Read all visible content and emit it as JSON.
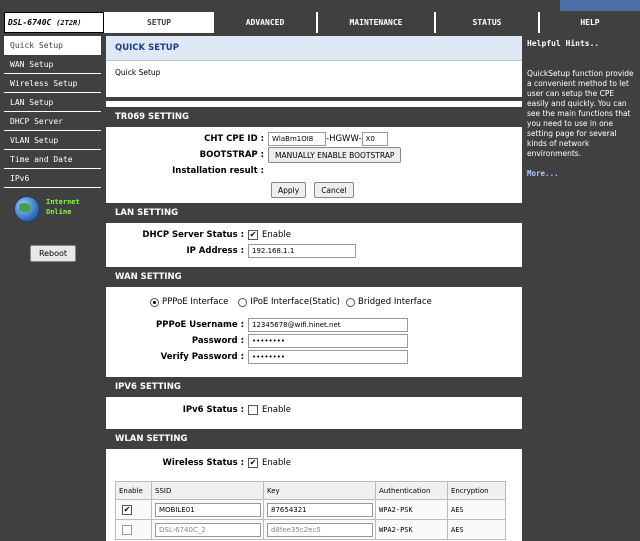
{
  "header": {
    "model": "DSL-6740C",
    "model_sub": "(2T2R)",
    "tabs": [
      {
        "label": "SETUP"
      },
      {
        "label": "ADVANCED"
      },
      {
        "label": "MAINTENANCE"
      },
      {
        "label": "STATUS"
      },
      {
        "label": "HELP"
      }
    ]
  },
  "sidebar": {
    "items": [
      {
        "label": "Quick Setup"
      },
      {
        "label": "WAN Setup"
      },
      {
        "label": "Wireless Setup"
      },
      {
        "label": "LAN Setup"
      },
      {
        "label": "DHCP Server"
      },
      {
        "label": "VLAN Setup"
      },
      {
        "label": "Time and Date"
      },
      {
        "label": "IPv6"
      }
    ],
    "status_line1": "Internet",
    "status_line2": "Online",
    "reboot_label": "Reboot"
  },
  "quick_setup": {
    "title": "QUICK SETUP",
    "body": "Quick Setup"
  },
  "tr069": {
    "title": "TR069 SETTING",
    "cpe_label": "CHT CPE ID :",
    "cpe_part1": "WlaBm1OI8",
    "cpe_sep": "-HGWW-",
    "cpe_part2": "X0",
    "bootstrap_label": "BOOTSTRAP :",
    "bootstrap_button": "MANUALLY ENABLE BOOTSTRAP",
    "install_label": "Installation result :",
    "apply": "Apply",
    "cancel": "Cancel"
  },
  "lan": {
    "title": "LAN SETTING",
    "dhcp_label": "DHCP Server Status :",
    "dhcp_enable": "Enable",
    "ip_label": "IP Address :",
    "ip_value": "192.168.1.1"
  },
  "wan": {
    "title": "WAN SETTING",
    "opt_pppoe": "PPPoE Interface",
    "opt_ipoe": "IPoE Interface(Static)",
    "opt_bridged": "Bridged Interface",
    "user_label": "PPPoE Username :",
    "user_value": "12345678@wifi.hinet.net",
    "pass_label": "Password :",
    "pass_value": "••••••••",
    "verify_label": "Verify Password :",
    "verify_value": "••••••••"
  },
  "ipv6": {
    "title": "IPV6 SETTING",
    "status_label": "IPv6 Status :",
    "enable": "Enable"
  },
  "wlan": {
    "title": "WLAN SETTING",
    "status_label": "Wireless Status :",
    "enable": "Enable",
    "columns": [
      "Enable",
      "SSID",
      "Key",
      "Authentication",
      "Encryption"
    ],
    "rows": [
      {
        "checked": "✔",
        "ssid": "MOBILE01",
        "key": "87654321",
        "auth": "WPA2-PSK",
        "enc": "AES"
      },
      {
        "checked": "",
        "ssid": "DSL-6740C_2",
        "key": "d8fee35c2ec5",
        "auth": "WPA2-PSK",
        "enc": "AES"
      }
    ]
  },
  "hints": {
    "title": "Helpful Hints..",
    "text": "QuickSetup function provide a convenient method to let user can setup the CPE easily and quickly. You can see the main functions that you need to use in one setting page for several kinds of network environments.",
    "more": "More..."
  }
}
